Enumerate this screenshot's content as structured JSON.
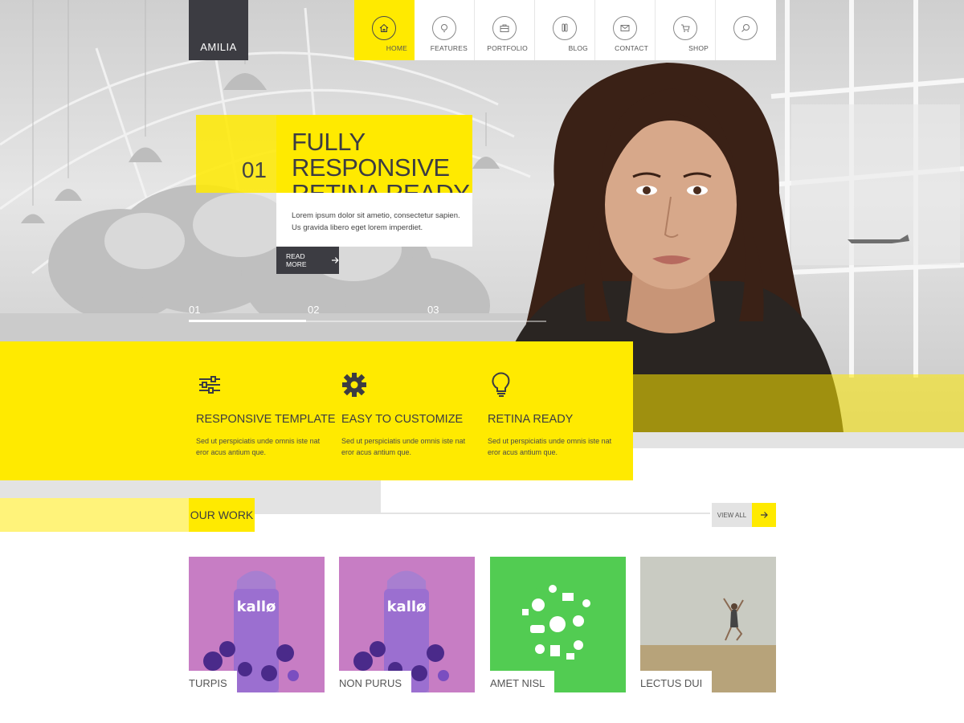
{
  "brand": {
    "logo_text": "AMILIA",
    "accent": "#ffea00",
    "dark": "#3c3c42"
  },
  "nav": [
    {
      "label": "HOME",
      "icon": "home-icon",
      "active": true
    },
    {
      "label": "FEATURES",
      "icon": "lightbulb-icon",
      "active": false
    },
    {
      "label": "PORTFOLIO",
      "icon": "briefcase-icon",
      "active": false
    },
    {
      "label": "BLOG",
      "icon": "pencils-icon",
      "active": false
    },
    {
      "label": "CONTACT",
      "icon": "envelope-icon",
      "active": false
    },
    {
      "label": "SHOP",
      "icon": "cart-icon",
      "active": false
    },
    {
      "label": "",
      "icon": "search-icon",
      "active": false
    }
  ],
  "slide": {
    "number": "01",
    "title_line1": "FULLY RESPONSIVE",
    "title_line2": "RETINA READY",
    "text_line1": "Lorem ipsum dolor sit ametio, consectetur sapien.",
    "text_line2": "Us gravida libero eget lorem imperdiet.",
    "read_more": "READ MORE",
    "indicators": [
      "01",
      "02",
      "03"
    ],
    "active_index": 0
  },
  "features": [
    {
      "icon": "sliders-icon",
      "title": "RESPONSIVE TEMPLATE",
      "text": "Sed ut perspiciatis unde omnis iste nat eror acus antium que."
    },
    {
      "icon": "gear-icon",
      "title": "EASY TO CUSTOMIZE",
      "text": "Sed ut perspiciatis unde omnis iste nat eror acus antium que."
    },
    {
      "icon": "lightbulb-icon",
      "title": "RETINA READY",
      "text": "Sed ut perspiciatis unde omnis iste nat eror acus antium que."
    }
  ],
  "work": {
    "title": "OUR WORK",
    "view_all": "VIEW ALL",
    "items": [
      {
        "label": "TURPIS",
        "bg": "#c77dc4"
      },
      {
        "label": "NON PURUS",
        "bg": "#c77dc4"
      },
      {
        "label": "AMET NISL",
        "bg": "#52cc52"
      },
      {
        "label": "LECTUS DUI",
        "bg": "#b9b3a0"
      }
    ]
  }
}
